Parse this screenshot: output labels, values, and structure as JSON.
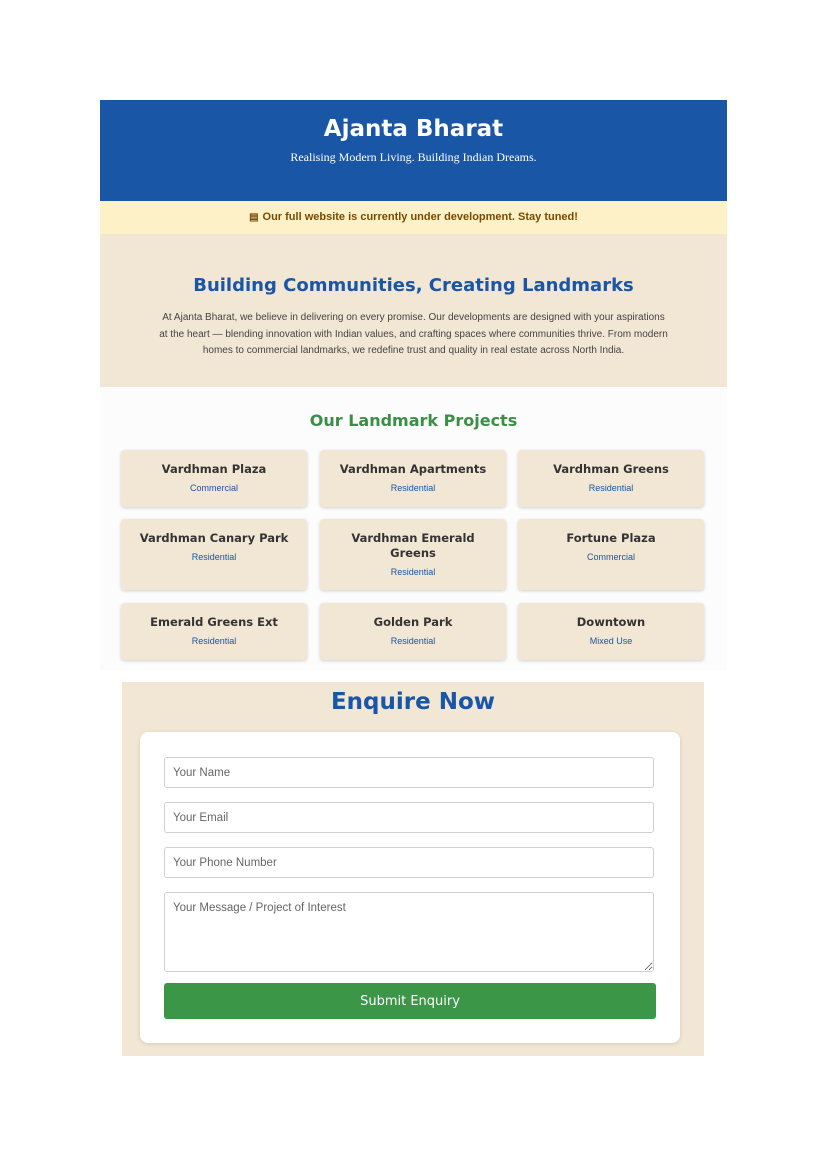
{
  "header": {
    "title": "Ajanta Bharat",
    "tagline": "Realising Modern Living. Building Indian Dreams."
  },
  "notice": {
    "icon": "construction-icon",
    "text": "Our full website is currently under development. Stay tuned!"
  },
  "about": {
    "heading": "Building Communities, Creating Landmarks",
    "body": "At Ajanta Bharat, we believe in delivering on every promise. Our developments are designed with your aspirations at the heart — blending innovation with Indian values, and crafting spaces where communities thrive. From modern homes to commercial landmarks, we redefine trust and quality in real estate across North India."
  },
  "projects": {
    "heading": "Our Landmark Projects",
    "items": [
      {
        "name": "Vardhman Plaza",
        "type": "Commercial"
      },
      {
        "name": "Vardhman Apartments",
        "type": "Residential"
      },
      {
        "name": "Vardhman Greens",
        "type": "Residential"
      },
      {
        "name": "Vardhman Canary Park",
        "type": "Residential"
      },
      {
        "name": "Vardhman Emerald Greens",
        "type": "Residential"
      },
      {
        "name": "Fortune Plaza",
        "type": "Commercial"
      },
      {
        "name": "Emerald Greens Ext",
        "type": "Residential"
      },
      {
        "name": "Golden Park",
        "type": "Residential"
      },
      {
        "name": "Downtown",
        "type": "Mixed Use"
      }
    ]
  },
  "enquiry": {
    "heading": "Enquire Now",
    "name_placeholder": "Your Name",
    "email_placeholder": "Your Email",
    "phone_placeholder": "Your Phone Number",
    "message_placeholder": "Your Message / Project of Interest",
    "submit_label": "Submit Enquiry"
  },
  "colors": {
    "primary": "#1a56a6",
    "accent_green": "#3b9648",
    "beige": "#f2e6d5",
    "notice_bg": "#fdf1c8"
  }
}
